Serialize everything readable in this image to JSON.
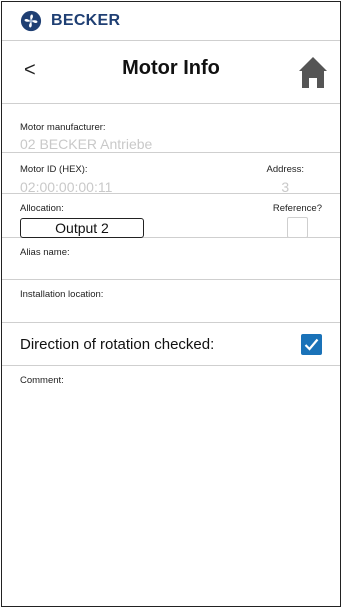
{
  "brand": {
    "name": "BECKER",
    "logo_icon": "becker-fan-logo-icon",
    "color": "#1f3f73"
  },
  "nav": {
    "back_label": "<",
    "title": "Motor Info",
    "home_icon": "home-icon"
  },
  "motor": {
    "manufacturer_label": "Motor manufacturer:",
    "manufacturer_value": "02 BECKER Antriebe",
    "id_label": "Motor ID (HEX):",
    "id_value": "02:00:00:00:11",
    "address_label": "Address:",
    "address_value": "3"
  },
  "allocation": {
    "label": "Allocation:",
    "value": "Output 2",
    "reference_label": "Reference?",
    "reference_checked": false
  },
  "alias": {
    "label": "Alias name:",
    "value": ""
  },
  "installation": {
    "label": "Installation location:",
    "value": ""
  },
  "direction": {
    "label": "Direction of rotation checked:",
    "checked": true,
    "check_color": "#1a72b8"
  },
  "comment": {
    "label": "Comment:",
    "value": ""
  }
}
